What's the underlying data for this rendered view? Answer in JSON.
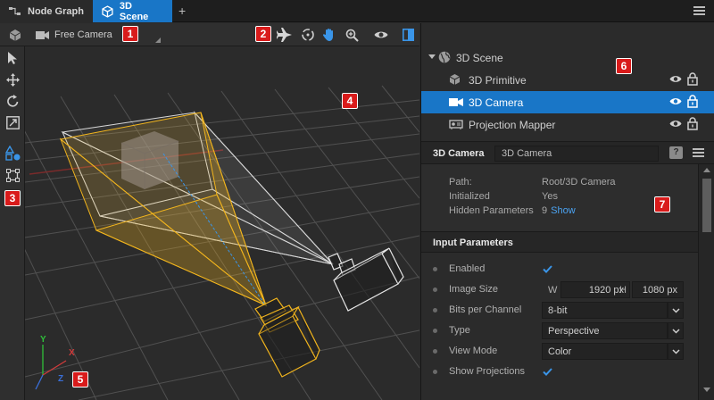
{
  "tabs": [
    {
      "label": "Node Graph",
      "icon": "node-graph-icon",
      "active": false
    },
    {
      "label": "3D Scene",
      "icon": "cube-icon",
      "active": true
    }
  ],
  "new_tab_label": "+",
  "viewport_toolbar": {
    "camera_select": "Free Camera",
    "icons": [
      "fly-icon",
      "orbit-icon",
      "pan-hand-icon",
      "zoom-icon",
      "visibility-icon",
      "panel-toggle-icon"
    ]
  },
  "left_tools": [
    "select-arrow-icon",
    "move-icon",
    "rotate-icon",
    "scale-icon",
    "shapes-icon",
    "bounding-box-icon"
  ],
  "badges": [
    "1",
    "2",
    "3",
    "4",
    "5",
    "6",
    "7"
  ],
  "axis_labels": {
    "x": "X",
    "y": "Y",
    "z": "Z"
  },
  "scene_tree": {
    "root": "3D Scene",
    "items": [
      {
        "label": "3D Primitive",
        "icon": "primitive-cube-icon",
        "selected": false
      },
      {
        "label": "3D Camera",
        "icon": "camera-icon",
        "selected": true
      },
      {
        "label": "Projection Mapper",
        "icon": "projector-icon",
        "selected": false
      }
    ]
  },
  "properties": {
    "title": "3D Camera",
    "name_value": "3D Camera",
    "help": "?",
    "info": {
      "path_label": "Path:",
      "path_value": "Root/3D Camera",
      "initialized_label": "Initialized",
      "initialized_value": "Yes",
      "hidden_label": "Hidden Parameters",
      "hidden_value": "9",
      "hidden_link": "Show"
    },
    "section_title": "Input Parameters",
    "params": {
      "enabled_label": "Enabled",
      "enabled_checked": true,
      "image_size_label": "Image Size",
      "w_label": "W",
      "w_value": "1920 px",
      "h_label": "H",
      "h_value": "1080 px",
      "bits_label": "Bits per Channel",
      "bits_value": "8-bit",
      "type_label": "Type",
      "type_value": "Perspective",
      "view_mode_label": "View Mode",
      "view_mode_value": "Color",
      "show_proj_label": "Show Projections",
      "show_proj_checked": true
    }
  },
  "colors": {
    "accent": "#1976c7",
    "badge": "#d91b1b",
    "frustum": "#f2b51d",
    "link": "#4ba3f2"
  }
}
